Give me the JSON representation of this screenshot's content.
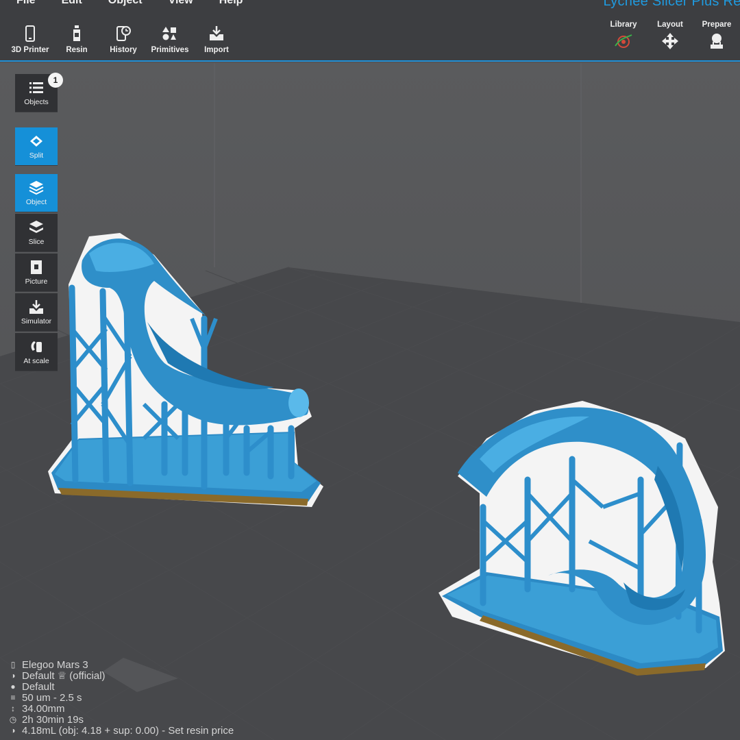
{
  "menu": [
    "File",
    "Edit",
    "Object",
    "View",
    "Help"
  ],
  "app_title": "Lychee Slicer Plus Res",
  "toolbar": [
    {
      "label": "3D Printer",
      "icon": "phone-printer-icon"
    },
    {
      "label": "Resin",
      "icon": "resin-bottle-icon"
    },
    {
      "label": "History",
      "icon": "history-icon"
    },
    {
      "label": "Primitives",
      "icon": "primitives-icon"
    },
    {
      "label": "Import",
      "icon": "import-icon"
    }
  ],
  "right_tools": [
    {
      "label": "Library",
      "icon": "library-icon"
    },
    {
      "label": "Layout",
      "icon": "move-arrows-icon"
    },
    {
      "label": "Prepare",
      "icon": "prepare-icon"
    }
  ],
  "side": {
    "objects_label": "Objects",
    "objects_count": "1",
    "items": [
      {
        "label": "Split",
        "active": true
      },
      {
        "label": "Object",
        "active": true
      },
      {
        "label": "Slice",
        "active": false
      },
      {
        "label": "Picture",
        "active": false
      },
      {
        "label": "Simulator",
        "active": false
      },
      {
        "label": "At scale",
        "active": false
      }
    ]
  },
  "status": {
    "printer": "Elegoo Mars 3",
    "resin_profile": "Default ♕ (official)",
    "color_profile": "Default",
    "layer": "50 um - 2.5 s",
    "height": "34.00mm",
    "time": "2h 30min 19s",
    "volume": "4.18mL (obj: 4.18 + sup: 0.00) - Set resin price"
  },
  "colors": {
    "accent": "#1f8fd6",
    "model": "#2f8fc9",
    "toolbar_bg": "#3d3e41",
    "viewport_bg": "#555658"
  }
}
